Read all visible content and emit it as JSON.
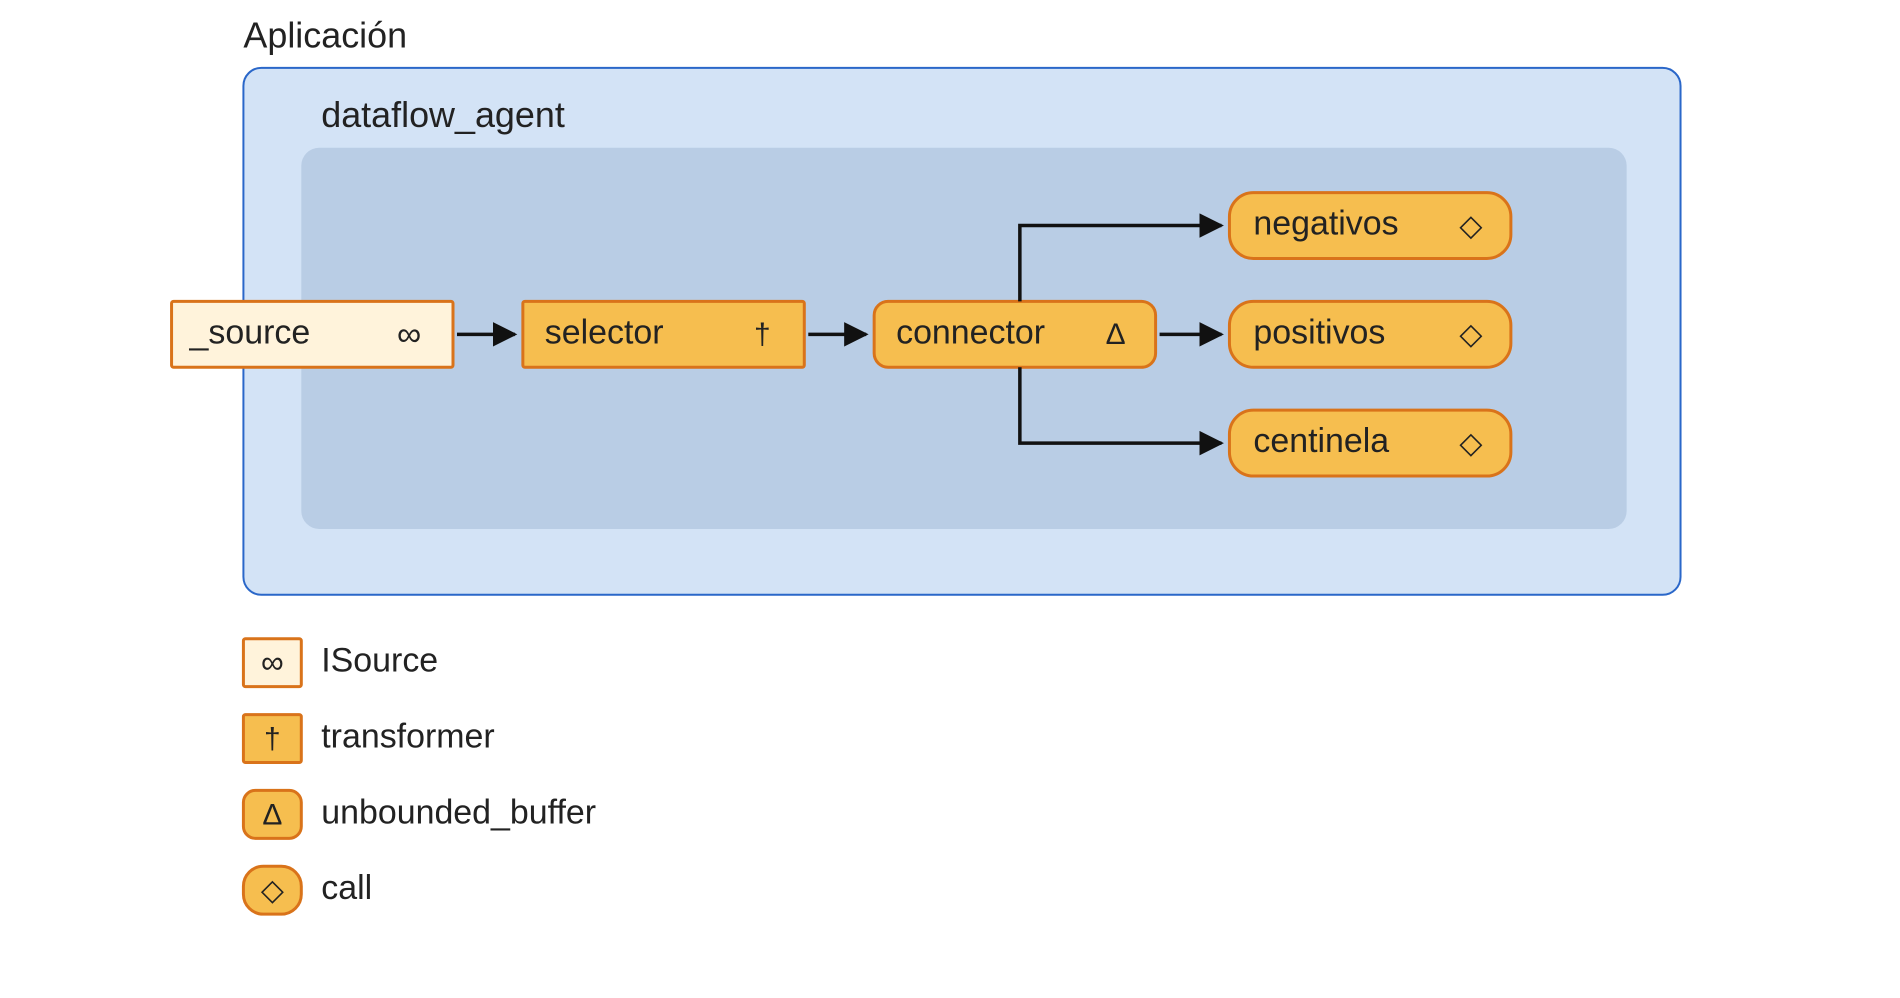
{
  "title": "Aplicación",
  "agent_title": "dataflow_agent",
  "nodes": {
    "source": {
      "label": "_source",
      "icon": "infinity"
    },
    "selector": {
      "label": "selector",
      "icon": "dagger"
    },
    "connector": {
      "label": "connector",
      "icon": "delta"
    },
    "negativos": {
      "label": "negativos",
      "icon": "diamond"
    },
    "positivos": {
      "label": "positivos",
      "icon": "diamond"
    },
    "centinela": {
      "label": "centinela",
      "icon": "diamond"
    }
  },
  "legend": [
    {
      "icon": "infinity",
      "label": "ISource",
      "swatch_fill": "#FFF3DB",
      "radius": 2
    },
    {
      "icon": "dagger",
      "label": "transformer",
      "swatch_fill": "#F6BE4F",
      "radius": 2
    },
    {
      "icon": "delta",
      "label": "unbounded_buffer",
      "swatch_fill": "#F6BE4F",
      "radius": 12
    },
    {
      "icon": "diamond",
      "label": "call",
      "swatch_fill": "#F6BE4F",
      "radius": 20
    }
  ],
  "icons": {
    "infinity": "∞",
    "dagger": "†",
    "delta": "Δ",
    "diamond": "◇"
  },
  "colors": {
    "outer_fill": "#D3E3F6",
    "outer_stroke": "#2A67C9",
    "inner_fill": "#B9CDE5",
    "block_stroke": "#D9731A",
    "block_light": "#FFF3DB",
    "block_dark": "#F6BE4F"
  }
}
